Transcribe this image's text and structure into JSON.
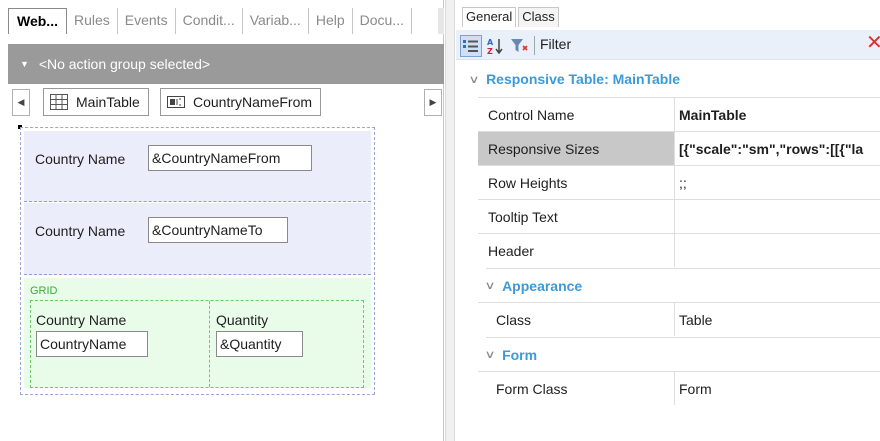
{
  "editor": {
    "tabs": [
      "Web...",
      "Rules",
      "Events",
      "Condit...",
      "Variab...",
      "Help",
      "Docu..."
    ],
    "action_group": "<No action group selected>",
    "breadcrumbs": [
      "MainTable",
      "CountryNameFrom"
    ],
    "rows": [
      {
        "label": "Country Name",
        "input": "&CountryNameFrom"
      },
      {
        "label": "Country Name",
        "input": "&CountryNameTo"
      }
    ],
    "grid": {
      "label": "GRID",
      "columns": [
        {
          "header": "Country Name",
          "value": "CountryName"
        },
        {
          "header": "Quantity",
          "value": "&Quantity"
        }
      ]
    }
  },
  "properties": {
    "tabs": [
      "General",
      "Class"
    ],
    "filter_label": "Filter",
    "section_title": "Responsive Table: MainTable",
    "rows": [
      {
        "name": "Control Name",
        "value": "MainTable"
      },
      {
        "name": "Responsive Sizes",
        "value": "[{\"scale\":\"sm\",\"rows\":[[{\"la"
      },
      {
        "name": "Row Heights",
        "value": ";;"
      },
      {
        "name": "Tooltip Text",
        "value": ""
      },
      {
        "name": "Header",
        "value": ""
      }
    ],
    "appearance": {
      "title": "Appearance",
      "rows": [
        {
          "name": "Class",
          "value": "Table"
        }
      ]
    },
    "form": {
      "title": "Form",
      "rows": [
        {
          "name": "Form Class",
          "value": "Form"
        }
      ]
    }
  },
  "colors": {
    "accent": "#3b9ad9",
    "group_bar": "#9a9a9a",
    "table_row_bg": "#ebeefa",
    "grid_bg": "#e9fbe9",
    "grid_label": "#3fa83f",
    "clear_x": "#d9332b"
  },
  "icons": {
    "categorized": "categorized-icon",
    "alphabetical": "sort-az-icon",
    "filter": "filter-icon",
    "clear": "close-icon",
    "table": "table-icon",
    "textbox": "textbox-icon"
  }
}
